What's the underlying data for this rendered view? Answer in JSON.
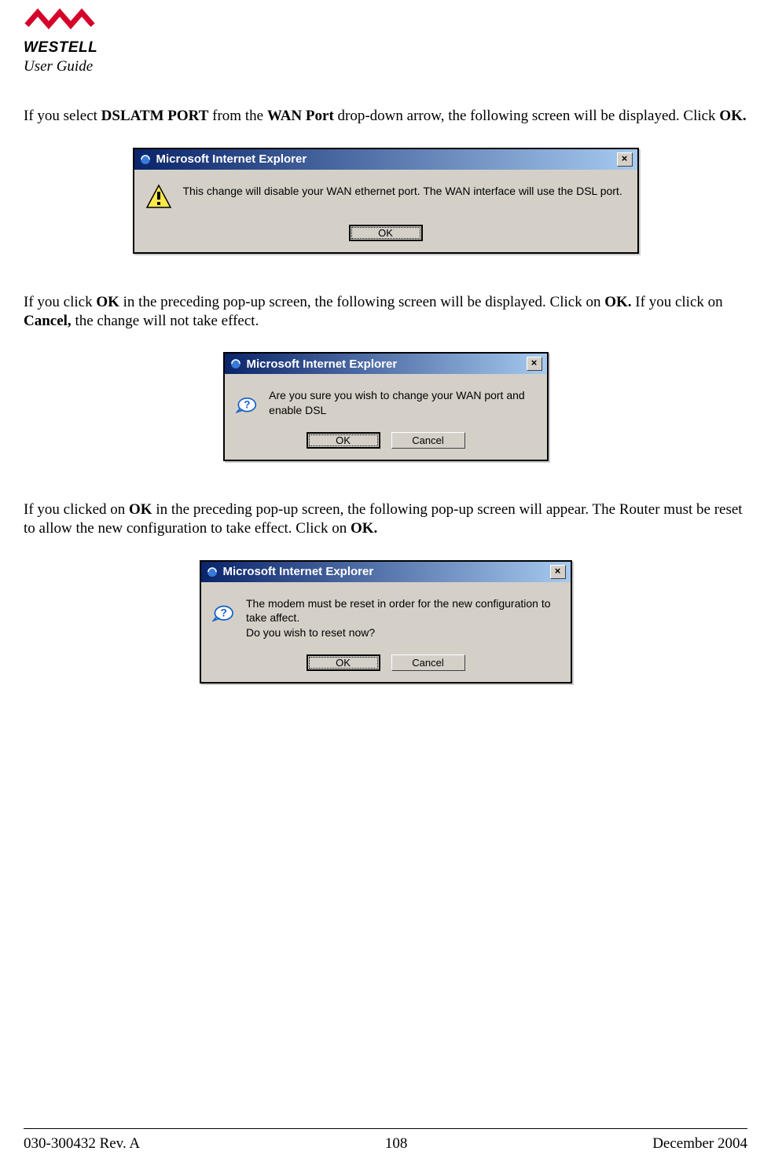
{
  "header": {
    "brand": "WESTELL",
    "doc_label": "User Guide"
  },
  "paragraphs": {
    "p1_pre": "If you select ",
    "p1_b1": "DSLATM PORT",
    "p1_mid1": " from the ",
    "p1_b2": "WAN Port",
    "p1_mid2": " drop-down arrow, the following screen will be displayed. Click ",
    "p1_b3": "OK.",
    "p2_pre": "If you click ",
    "p2_b1": "OK",
    "p2_mid1": " in the preceding pop-up screen, the following screen will be displayed. Click on ",
    "p2_b2": "OK.",
    "p2_mid2": " If you click on ",
    "p2_b3": "Cancel,",
    "p2_post": " the change will not take effect.",
    "p3_pre": "If you clicked on ",
    "p3_b1": "OK",
    "p3_mid1": " in the preceding pop-up screen, the following pop-up screen will appear. The Router must be reset to allow the new configuration to take effect. Click on ",
    "p3_b2": "OK."
  },
  "dialogs": {
    "d1": {
      "title": "Microsoft Internet Explorer",
      "message": "This change will disable your WAN ethernet port. The WAN interface will use the DSL port.",
      "ok": "OK"
    },
    "d2": {
      "title": "Microsoft Internet Explorer",
      "message": "Are you sure you wish to change your WAN port and enable DSL",
      "ok": "OK",
      "cancel": "Cancel"
    },
    "d3": {
      "title": "Microsoft Internet Explorer",
      "message_l1": "The modem must be reset in order for the new configuration to take affect.",
      "message_l2": "Do you wish to reset now?",
      "ok": "OK",
      "cancel": "Cancel"
    }
  },
  "footer": {
    "left": "030-300432 Rev. A",
    "center": "108",
    "right": "December 2004"
  },
  "close_glyph": "×"
}
